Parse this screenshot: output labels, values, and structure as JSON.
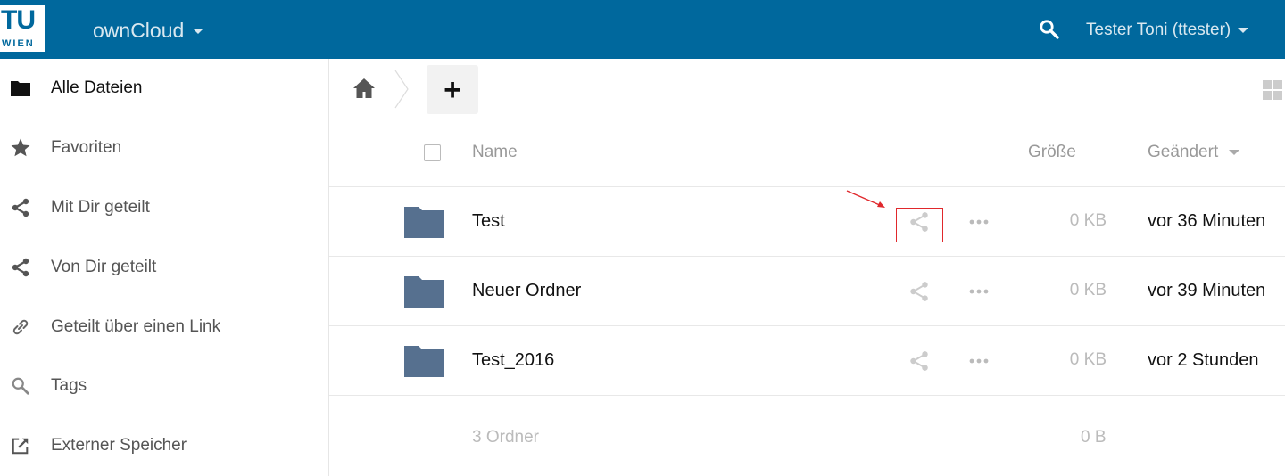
{
  "header": {
    "logo_top": "TU",
    "logo_bottom": "WIEN",
    "app_name": "ownCloud",
    "user_name": "Tester Toni (ttester)",
    "bg_color": "#00689d"
  },
  "sidebar": {
    "items": [
      {
        "label": "Alle Dateien",
        "icon": "folder-icon",
        "active": true
      },
      {
        "label": "Favoriten",
        "icon": "star-icon"
      },
      {
        "label": "Mit Dir geteilt",
        "icon": "share-icon"
      },
      {
        "label": "Von Dir geteilt",
        "icon": "share-icon"
      },
      {
        "label": "Geteilt über einen Link",
        "icon": "link-icon"
      },
      {
        "label": "Tags",
        "icon": "search-icon"
      },
      {
        "label": "Externer Speicher",
        "icon": "external-link-icon"
      }
    ]
  },
  "controls": {
    "add_label": "+"
  },
  "table": {
    "headers": {
      "name": "Name",
      "size": "Größe",
      "modified": "Geändert"
    },
    "rows": [
      {
        "name": "Test",
        "size": "0 KB",
        "modified": "vor 36 Minuten"
      },
      {
        "name": "Neuer Ordner",
        "size": "0 KB",
        "modified": "vor 39 Minuten"
      },
      {
        "name": "Test_2016",
        "size": "0 KB",
        "modified": "vor 2 Stunden"
      }
    ],
    "summary": {
      "count": "3 Ordner",
      "size": "0 B"
    }
  },
  "colors": {
    "folder": "#56708f",
    "annotation": "#e0282c"
  }
}
